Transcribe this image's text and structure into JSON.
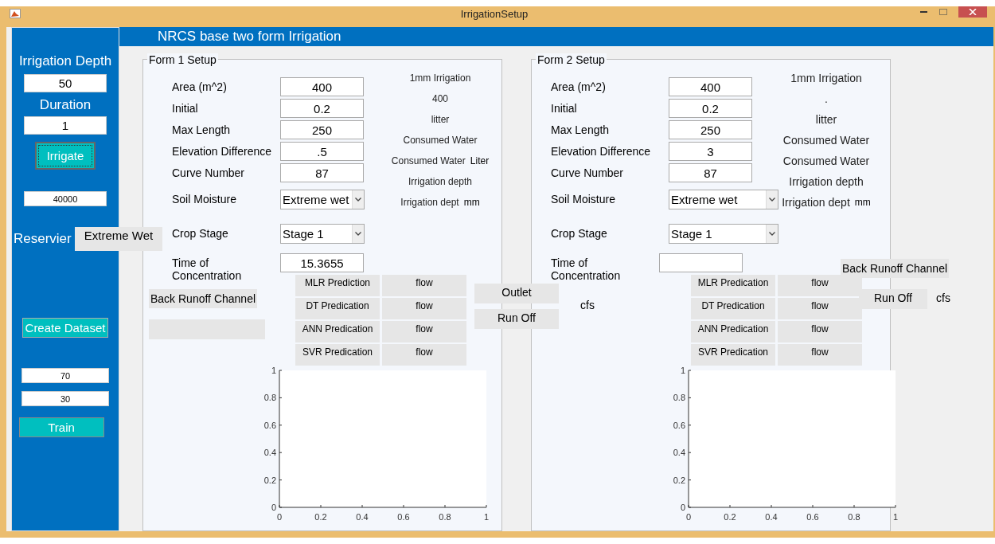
{
  "window": {
    "title": "IrrigationSetup"
  },
  "sidebar": {
    "depth_label": "Irrigation Depth",
    "depth_value": "50",
    "duration_label": "Duration",
    "duration_value": "1",
    "irrigate_button": "Irrigate",
    "total_value": "40000",
    "reservoir_label": "Reservier",
    "reservoir_status": "Extreme Wet",
    "create_button": "Create Dataset",
    "split_values": [
      "70",
      "30"
    ],
    "train_button": "Train"
  },
  "header": "NRCS base two form Irrigation",
  "forms": [
    {
      "title": "Form 1 Setup",
      "fields": [
        {
          "label": "Area (m^2)",
          "kind": "input",
          "value": "400"
        },
        {
          "label": "Initial",
          "kind": "input",
          "value": "0.2"
        },
        {
          "label": "Max Length",
          "kind": "input",
          "value": "250"
        },
        {
          "label": "Elevation Difference",
          "kind": "input",
          "value": ".5"
        },
        {
          "label": "Curve Number",
          "kind": "input",
          "value": "87"
        },
        {
          "label": "Soil Moisture",
          "kind": "select",
          "value": "Extreme wet"
        },
        {
          "label": "Crop Stage",
          "kind": "select",
          "value": "Stage 1"
        },
        {
          "label": "Time of Concentration",
          "kind": "input",
          "value": "15.3655"
        }
      ],
      "results": [
        {
          "text": "1mm Irrigation"
        },
        {
          "text": "400"
        },
        {
          "text": "litter"
        },
        {
          "text": "Consumed Water"
        },
        {
          "text": "Consumed Water",
          "unit": "Liter"
        },
        {
          "text": "Irrigation depth"
        },
        {
          "text": "Irrigation dept",
          "unit": "mm"
        }
      ],
      "back_runoff": "Back Runoff Channel",
      "predictions": [
        {
          "label": "MLR Prediction",
          "value": "flow"
        },
        {
          "label": "DT Predication",
          "value": "flow"
        },
        {
          "label": "ANN Predication",
          "value": "flow"
        },
        {
          "label": "SVR Predication",
          "value": "flow"
        }
      ],
      "outputs": [
        "Outlet",
        "Run Off"
      ],
      "unit": "cfs",
      "chart_data": {
        "type": "line",
        "xlim": [
          0,
          1
        ],
        "ylim": [
          0,
          1
        ],
        "xticks": [
          0,
          0.2,
          0.4,
          0.6,
          0.8,
          1
        ],
        "yticks": [
          0,
          0.2,
          0.4,
          0.6,
          0.8,
          1
        ]
      }
    },
    {
      "title": "Form 2 Setup",
      "fields": [
        {
          "label": "Area (m^2)",
          "kind": "input",
          "value": "400"
        },
        {
          "label": "Initial",
          "kind": "input",
          "value": "0.2"
        },
        {
          "label": "Max Length",
          "kind": "input",
          "value": "250"
        },
        {
          "label": "Elevation Difference",
          "kind": "input",
          "value": "3"
        },
        {
          "label": "Curve Number",
          "kind": "input",
          "value": "87"
        },
        {
          "label": "Soil Moisture",
          "kind": "select",
          "value": "Extreme wet"
        },
        {
          "label": "Crop Stage",
          "kind": "select",
          "value": "Stage 1"
        },
        {
          "label": "Time of Concentration",
          "kind": "input"
        }
      ],
      "results": [
        {
          "text": "1mm Irrigation"
        },
        {
          "text": "."
        },
        {
          "text": "litter"
        },
        {
          "text": "Consumed Water"
        },
        {
          "text": "Consumed Water"
        },
        {
          "text": "Irrigation depth"
        },
        {
          "text": "Irrigation dept",
          "unit": "mm"
        }
      ],
      "back_runoff": "Back Runoff Channel",
      "predictions": [
        {
          "label": "MLR Predication",
          "value": "flow"
        },
        {
          "label": "DT Predication",
          "value": "flow"
        },
        {
          "label": "ANN  Predication",
          "value": "flow"
        },
        {
          "label": "SVR Predication",
          "value": "flow"
        }
      ],
      "outputs": [
        "Run Off"
      ],
      "unit": "cfs",
      "chart_data": {
        "type": "line",
        "xlim": [
          0,
          1
        ],
        "ylim": [
          0,
          1
        ],
        "xticks": [
          0,
          0.2,
          0.4,
          0.6,
          0.8,
          1
        ],
        "yticks": [
          0,
          0.2,
          0.4,
          0.6,
          0.8,
          1
        ]
      }
    }
  ]
}
